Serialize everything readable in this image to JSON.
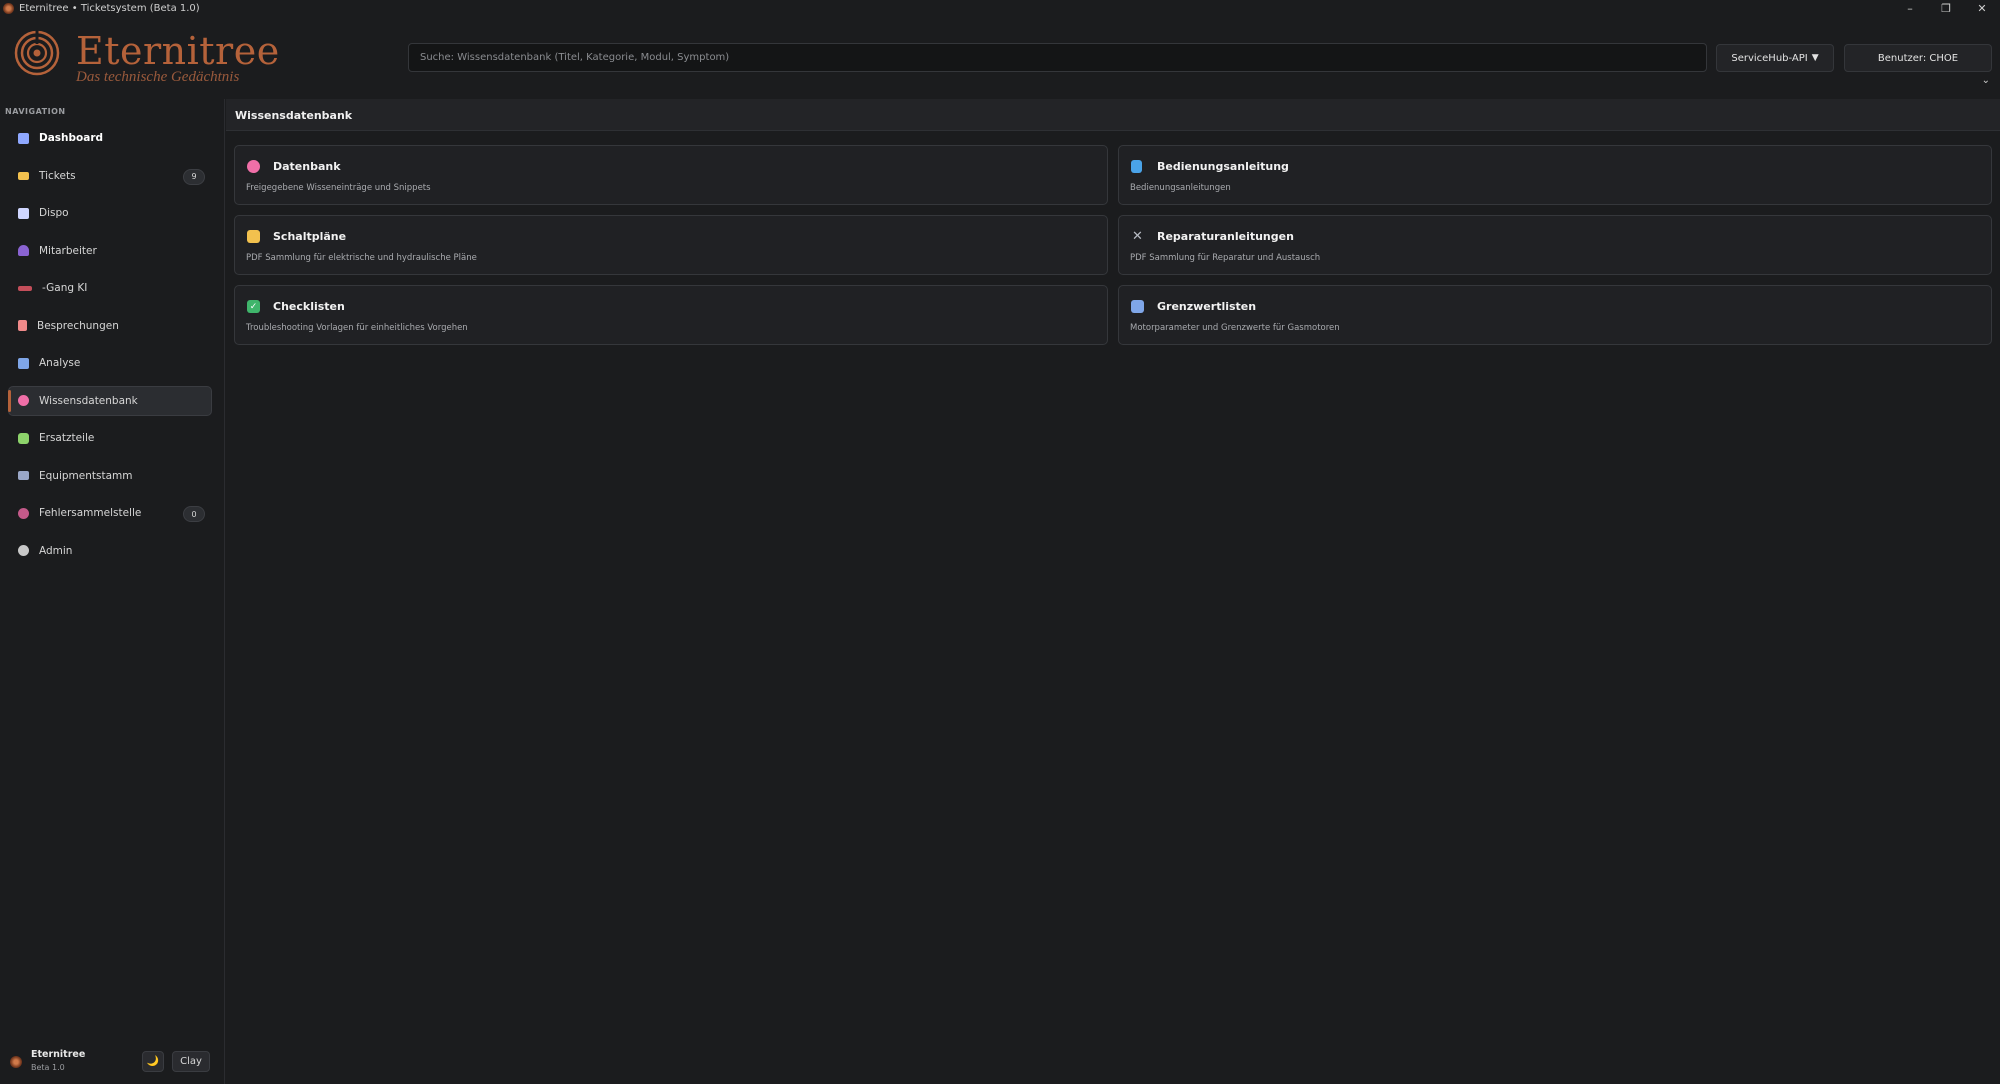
{
  "window": {
    "title": "Eternitree • Ticketsystem (Beta 1.0)",
    "minimize": "–",
    "maximize": "❐",
    "close": "✕"
  },
  "header": {
    "brand": "Eternitree",
    "tagline": "Das technische Gedächtnis",
    "search_placeholder": "Suche: Wissensdatenbank (Titel, Kategorie, Modul, Symptom)",
    "api_button": "ServiceHub-API",
    "api_caret": "▼",
    "user_button": "Benutzer: CHOE",
    "user_chevron": "⌄"
  },
  "sidebar": {
    "heading": "NAVIGATION",
    "items": [
      {
        "label": "Dashboard",
        "icon": "dashboard-icon",
        "color": "#8fa8ff"
      },
      {
        "label": "Tickets",
        "icon": "ticket-icon",
        "color": "#f2c14e",
        "badge": "9"
      },
      {
        "label": "Dispo",
        "icon": "calendar-icon",
        "color": "#cfd6ff"
      },
      {
        "label": "Mitarbeiter",
        "icon": "person-icon",
        "color": "#8a63d2"
      },
      {
        "label": "-Gang KI",
        "icon": "ai-icon",
        "color": "#c44e5a"
      },
      {
        "label": "Besprechungen",
        "icon": "document-icon",
        "color": "#f08a8a"
      },
      {
        "label": "Analyse",
        "icon": "chart-icon",
        "color": "#7fa6e8"
      },
      {
        "label": "Wissensdatenbank",
        "icon": "brain-icon",
        "color": "#f06fa8",
        "active": true
      },
      {
        "label": "Ersatzteile",
        "icon": "puzzle-icon",
        "color": "#8dd36b"
      },
      {
        "label": "Equipmentstamm",
        "icon": "factory-icon",
        "color": "#9aa7c7"
      },
      {
        "label": "Fehlersammelstelle",
        "icon": "bug-icon",
        "color": "#c45a8a",
        "badge": "0"
      },
      {
        "label": "Admin",
        "icon": "gear-icon",
        "color": "#c8c8c8"
      }
    ],
    "footer": {
      "name": "Eternitree",
      "version": "Beta 1.0",
      "theme_icon": "🌙",
      "theme_label": "Clay"
    }
  },
  "main": {
    "section_title": "Wissensdatenbank",
    "cards": [
      {
        "title": "Datenbank",
        "desc": "Freigegebene Wisseneinträge und Snippets",
        "icon": "brain-icon",
        "color": "#f06fa8"
      },
      {
        "title": "Bedienungsanleitung",
        "desc": "Bedienungsanleitungen",
        "icon": "book-icon",
        "color": "#4aa3e8"
      },
      {
        "title": "Schaltpläne",
        "desc": "PDF Sammlung für elektrische und hydraulische Pläne",
        "icon": "folder-icon",
        "color": "#f2c14e"
      },
      {
        "title": "Reparaturanleitungen",
        "desc": "PDF Sammlung für Reparatur und Austausch",
        "icon": "tools-icon",
        "color": "#b8bcc4"
      },
      {
        "title": "Checklisten",
        "desc": "Troubleshooting Vorlagen für einheitliches Vorgehen",
        "icon": "check-icon",
        "color": "#3fb56b"
      },
      {
        "title": "Grenzwertlisten",
        "desc": "Motorparameter und Grenzwerte für Gasmotoren",
        "icon": "chart-icon",
        "color": "#7fa6e8"
      }
    ]
  },
  "colors": {
    "accent": "#b5623a",
    "background": "#1b1c1e"
  }
}
